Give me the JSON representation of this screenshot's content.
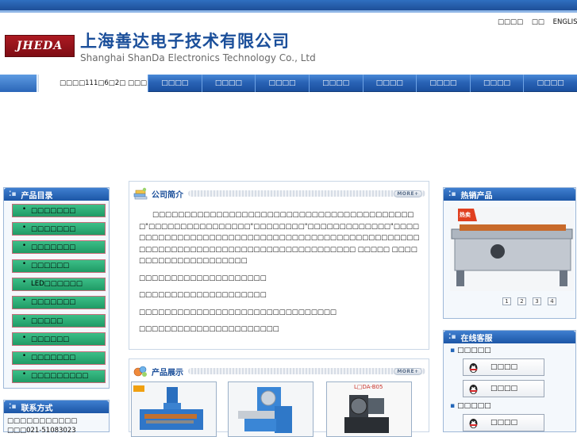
{
  "brand": {
    "logo_text": "JHEDA",
    "company_cn": "上海善达电子技术有限公司",
    "company_en": "Shanghai ShanDa Electronics Technology Co., Ltd"
  },
  "top_links": [
    "□□□□",
    "□□",
    "ENGLISH"
  ],
  "date_text": "□□□□111□6□2□ □□□",
  "nav": [
    "□□□□",
    "□□□□",
    "□□□□",
    "□□□□",
    "□□□□",
    "□□□□",
    "□□□□",
    "□□□□"
  ],
  "sidebar": {
    "categories_title": "产品目录",
    "categories": [
      "□□□□□□□",
      "□□□□□□□",
      "□□□□□□□",
      "□□□□□□",
      "LED□□□□□□",
      "□□□□□□□",
      "□□□□□",
      "□□□□□□",
      "□□□□□□□",
      "□□□□□□□□□"
    ],
    "contact_title": "联系方式",
    "contact_lines": [
      "□□□□□□□□□□□",
      "□□□021-51083023"
    ]
  },
  "about": {
    "title": "公司简介",
    "more": "MORE+",
    "paragraphs": [
      "□□□□□□□□□□□□□□□□□□□□□□□□□□□□□□□□□□□□□□□□□□\"□□□□□□□□□□□□□□□□\"□□□□□□□□\"□□□□□□□□□□□□□\"□□□□□□□□□□□□□□□□□□□□□□□□□□□□□□□□□□□□□□□□□□□□□□□□□□□□□□□□□□□□□□□□□□□□□□□□□□□□□□□□□□ □□□□□ □□□□□□□□□□□□□□□□□□□□□",
      "□□□□□□□□□□□□□□□□□□□□",
      "□□□□□□□□□□□□□□□□□□□□",
      "□□□□□□□□□□□□□□□□□□□□□□□□□□□□□□□",
      "□□□□□□□□□□□□□□□□□□□□□□"
    ]
  },
  "products": {
    "title": "产品展示",
    "more": "MORE+",
    "tag_2": "L□DA-B05"
  },
  "hot": {
    "title": "热销产品",
    "badge": "热卖",
    "pages": [
      "1",
      "2",
      "3",
      "4"
    ]
  },
  "service": {
    "title": "在线客服",
    "groups": [
      {
        "name": "□□□□□",
        "buttons": [
          "□□□□",
          "□□□□"
        ]
      },
      {
        "name": "□□□□□",
        "buttons": [
          "□□□□"
        ]
      }
    ]
  },
  "colors": {
    "nav_blue": "#2a64b6",
    "category_green": "#1f9a65",
    "brand_red": "#ac1a22",
    "title_blue": "#1b4f9a"
  }
}
